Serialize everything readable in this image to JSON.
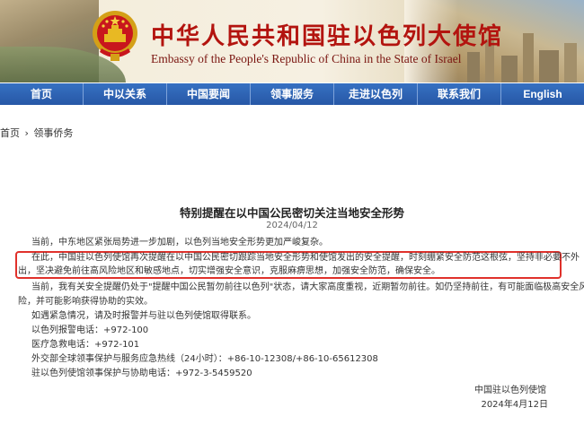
{
  "header": {
    "title_cn": "中华人民共和国驻以色列大使馆",
    "title_en": "Embassy of the People's Republic of China in the State of Israel",
    "emblem_icon": "national-emblem-icon"
  },
  "nav": {
    "items": [
      {
        "label": "首页"
      },
      {
        "label": "中以关系"
      },
      {
        "label": "中国要闻"
      },
      {
        "label": "领事服务"
      },
      {
        "label": "走进以色列"
      },
      {
        "label": "联系我们"
      },
      {
        "label": "English"
      }
    ]
  },
  "breadcrumb": {
    "home": "首页",
    "separator": "›",
    "current": "领事侨务"
  },
  "article": {
    "title": "特别提醒在以中国公民密切关注当地安全形势",
    "date": "2024/04/12",
    "paragraphs": [
      "当前，中东地区紧张局势进一步加剧，以色列当地安全形势更加严峻复杂。",
      "在此，中国驻以色列使馆再次提醒在以中国公民密切跟踪当地安全形势和使馆发出的安全提醒，时刻绷紧安全防范这根弦，坚持非必要不外",
      "出，坚决避免前往高风险地区和敏感地点，切实增强安全意识，克服麻痹思想，加强安全防范，确保安全。",
      "当前，我有关安全提醒仍处于\"提醒中国公民暂勿前往以色列\"状态，请大家高度重视，近期暂勿前往。如仍坚持前往，有可能面临极高安全风",
      "险，并可能影响获得协助的实效。",
      "如遇紧急情况，请及时报警并与驻以色列使馆取得联系。",
      "以色列报警电话：+972-100",
      "医疗急救电话：+972-101",
      "外交部全球领事保护与服务应急热线（24小时）：+86-10-12308/+86-10-65612308",
      "驻以色列使馆领事保护与协助电话：+972-3-5459520"
    ],
    "signature": "中国驻以色列使馆",
    "signature_date": "2024年4月12日"
  },
  "colors": {
    "nav_bg": "#2f65b5",
    "title_red": "#b3140f",
    "highlight_border": "#e0312b"
  }
}
